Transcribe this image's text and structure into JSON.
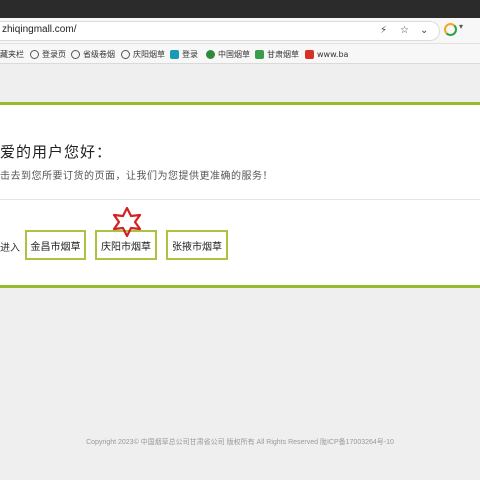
{
  "browser": {
    "url": "zhiqingmall.com/",
    "toolbar_icons": [
      "flash-icon",
      "star-outline-icon",
      "chevron-down-icon"
    ],
    "bookmarks": [
      {
        "label": "藏夹栏",
        "icon": "none"
      },
      {
        "label": "登录页",
        "icon": "globe"
      },
      {
        "label": "省级卷烟",
        "icon": "globe"
      },
      {
        "label": "庆阳烟草",
        "icon": "globe"
      },
      {
        "label": "登录",
        "icon": "teal"
      },
      {
        "label": "中国烟草",
        "icon": "green"
      },
      {
        "label": "甘肃烟草",
        "icon": "green"
      },
      {
        "label": "www.ba",
        "icon": "red"
      }
    ]
  },
  "page": {
    "greeting": "爱的用户您好：",
    "subtext": "击去到您所要订货的页面，让我们为您提供更准确的服务！",
    "enter_label": "进入",
    "cities": [
      "金昌市烟草",
      "庆阳市烟草",
      "张掖市烟草"
    ],
    "accent_color": "#96bb2b",
    "copyright": "Copyright 2023© 中国烟草总公司甘肃省公司 版权所有 All Rights Reserved 陇ICP备17003264号-10"
  }
}
